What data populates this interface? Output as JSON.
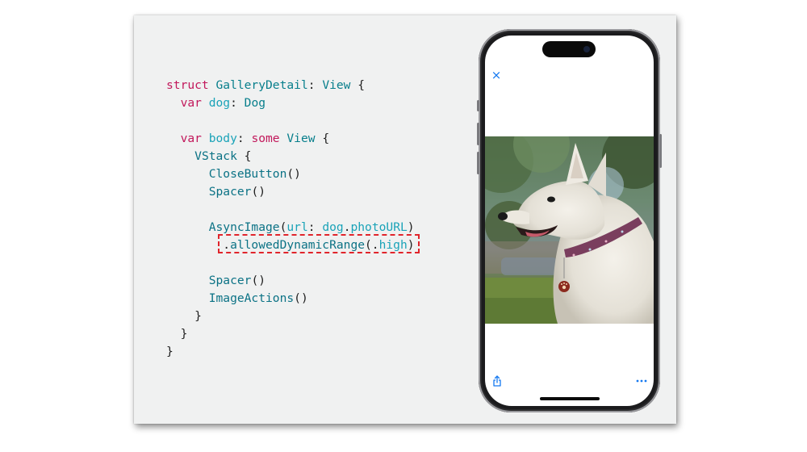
{
  "code": {
    "lines": [
      [
        {
          "t": "struct",
          "c": "kw"
        },
        {
          "t": " GalleryDetail",
          "c": "ty"
        },
        {
          "t": ": ",
          "c": "pl"
        },
        {
          "t": "View",
          "c": "ty"
        },
        {
          "t": " {",
          "c": "pl"
        }
      ],
      [
        {
          "t": "  ",
          "c": "pl"
        },
        {
          "t": "var",
          "c": "kw"
        },
        {
          "t": " dog",
          "c": "pr"
        },
        {
          "t": ": ",
          "c": "pl"
        },
        {
          "t": "Dog",
          "c": "ty"
        }
      ],
      [
        {
          "t": "",
          "c": "pl"
        }
      ],
      [
        {
          "t": "  ",
          "c": "pl"
        },
        {
          "t": "var",
          "c": "kw"
        },
        {
          "t": " body",
          "c": "pr"
        },
        {
          "t": ": ",
          "c": "pl"
        },
        {
          "t": "some",
          "c": "kw"
        },
        {
          "t": " View",
          "c": "ty"
        },
        {
          "t": " {",
          "c": "pl"
        }
      ],
      [
        {
          "t": "    ",
          "c": "pl"
        },
        {
          "t": "VStack",
          "c": "fn"
        },
        {
          "t": " {",
          "c": "pl"
        }
      ],
      [
        {
          "t": "      ",
          "c": "pl"
        },
        {
          "t": "CloseButton",
          "c": "fn"
        },
        {
          "t": "()",
          "c": "pl"
        }
      ],
      [
        {
          "t": "      ",
          "c": "pl"
        },
        {
          "t": "Spacer",
          "c": "fn"
        },
        {
          "t": "()",
          "c": "pl"
        }
      ],
      [
        {
          "t": "",
          "c": "pl"
        }
      ],
      [
        {
          "t": "      ",
          "c": "pl"
        },
        {
          "t": "AsyncImage",
          "c": "fn"
        },
        {
          "t": "(",
          "c": "pl"
        },
        {
          "t": "url",
          "c": "pr"
        },
        {
          "t": ": ",
          "c": "pl"
        },
        {
          "t": "dog",
          "c": "pr"
        },
        {
          "t": ".",
          "c": "pl"
        },
        {
          "t": "photoURL",
          "c": "pr"
        },
        {
          "t": ")",
          "c": "pl"
        }
      ],
      [
        {
          "t": "        .",
          "c": "pl"
        },
        {
          "t": "allowedDynamicRange",
          "c": "fn"
        },
        {
          "t": "(.",
          "c": "pl"
        },
        {
          "t": "high",
          "c": "pr"
        },
        {
          "t": ")",
          "c": "pl"
        }
      ],
      [
        {
          "t": "",
          "c": "pl"
        }
      ],
      [
        {
          "t": "      ",
          "c": "pl"
        },
        {
          "t": "Spacer",
          "c": "fn"
        },
        {
          "t": "()",
          "c": "pl"
        }
      ],
      [
        {
          "t": "      ",
          "c": "pl"
        },
        {
          "t": "ImageActions",
          "c": "fn"
        },
        {
          "t": "()",
          "c": "pl"
        }
      ],
      [
        {
          "t": "    }",
          "c": "pl"
        }
      ],
      [
        {
          "t": "  }",
          "c": "pl"
        }
      ],
      [
        {
          "t": "}",
          "c": "pl"
        }
      ]
    ],
    "highlighted_line": 10
  },
  "phone": {
    "close_icon": "close-icon",
    "close_glyph": "×",
    "photo": "dog-photo",
    "share_icon": "share-icon",
    "more_icon": "more-icon",
    "accent_color": "#1478f0"
  },
  "colors": {
    "keyword": "#c2185b",
    "type": "#087f8c",
    "highlight_border": "#e0242b",
    "slide_background": "#f0f1f1"
  }
}
